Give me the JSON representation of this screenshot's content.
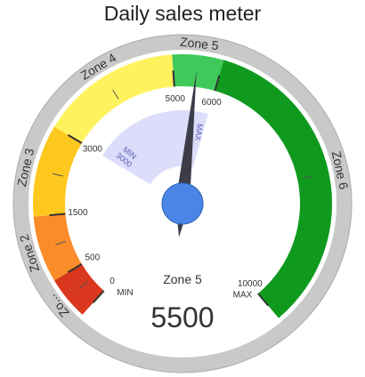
{
  "title": "Daily sales meter",
  "chart_data": {
    "type": "gauge",
    "title": "Daily sales meter",
    "min": 0,
    "max": 10000,
    "value": 5500,
    "value_label": "5500",
    "current_zone_label": "Zone 5",
    "min_label": "MIN",
    "max_label": "MAX",
    "tick_values": [
      0,
      500,
      1500,
      3000,
      5000,
      6000,
      10000
    ],
    "tick_labels": [
      "0",
      "500",
      "1500",
      "3000",
      "5000",
      "6000",
      "10000"
    ],
    "zones": [
      {
        "name": "Zo...",
        "from": 0,
        "to": 500,
        "color": "#d9381e"
      },
      {
        "name": "Zone 2",
        "from": 500,
        "to": 1500,
        "color": "#fb8c2a"
      },
      {
        "name": "Zone 3",
        "from": 1500,
        "to": 3000,
        "color": "#ffc81f"
      },
      {
        "name": "Zone 4",
        "from": 3000,
        "to": 5000,
        "color": "#fff25f"
      },
      {
        "name": "Zone 5",
        "from": 5000,
        "to": 6000,
        "color": "#3ec95a"
      },
      {
        "name": "Zone 6",
        "from": 6000,
        "to": 10000,
        "color": "#0f9a1e"
      }
    ],
    "min_max_band": {
      "from": 3000,
      "to": 6000,
      "color": "#dcdcfb",
      "min_label": "MIN 3000",
      "max_label": "MAX 6000"
    },
    "needle_color": "#3d3d4a",
    "hub_color": "#4a86e8"
  }
}
